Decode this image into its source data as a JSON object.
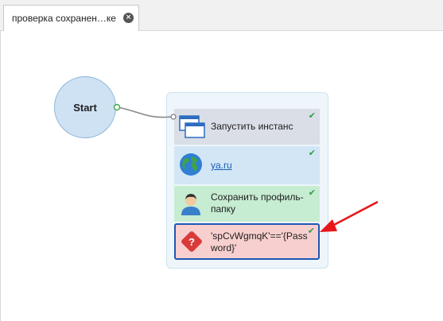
{
  "tab": {
    "title": "проверка сохранен…ке",
    "close_glyph": "×"
  },
  "start_node": {
    "label": "Start"
  },
  "blocks": [
    {
      "label": "Запустить инстанс",
      "icon": "windows-icon",
      "status": "done"
    },
    {
      "label": "ya.ru",
      "icon": "globe-icon",
      "status": "done"
    },
    {
      "label": "Сохранить профиль-",
      "label2": "папку",
      "icon": "user-icon",
      "status": "done"
    },
    {
      "label": "'spCvWgmqK'=='{Pass",
      "label2": "word}'",
      "icon": "question-diamond-icon",
      "status": "selected"
    }
  ],
  "status_glyph": "✔",
  "colors": {
    "annotation_arrow": "#e8161b",
    "selection_border": "#1f57b5",
    "condition_block_bg": "#f8cfcf"
  }
}
